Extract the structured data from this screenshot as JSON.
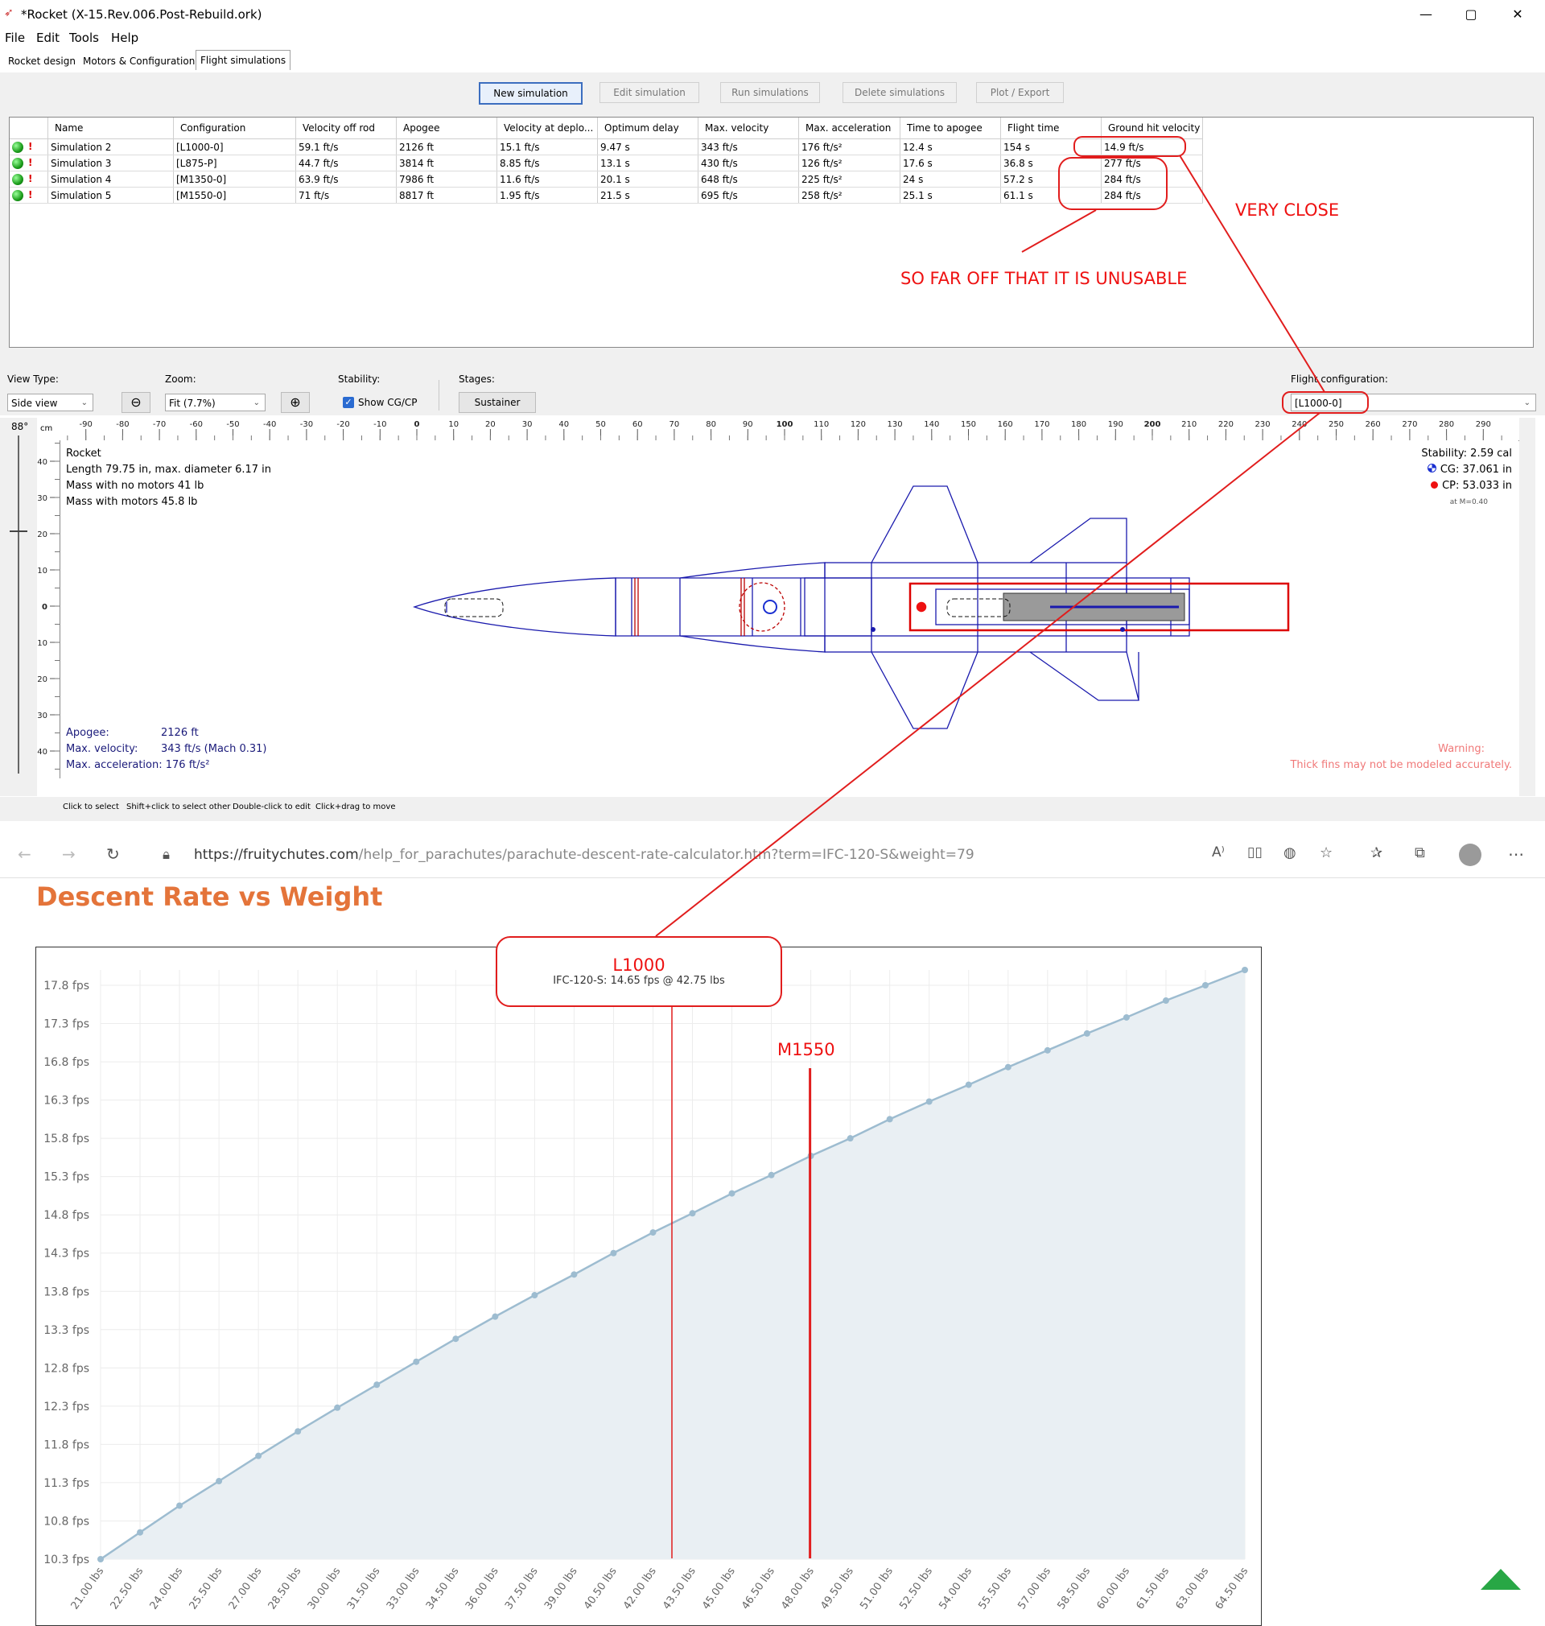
{
  "window": {
    "title": "*Rocket (X-15.Rev.006.Post-Rebuild.ork)",
    "minimize": "—",
    "restore": "▢",
    "close": "✕"
  },
  "menu": [
    "File",
    "Edit",
    "Tools",
    "Help"
  ],
  "tabs": [
    "Rocket design",
    "Motors & Configuration",
    "Flight simulations"
  ],
  "toolbar": {
    "new": "New simulation",
    "edit": "Edit simulation",
    "run": "Run simulations",
    "delete": "Delete simulations",
    "plot": "Plot / Export"
  },
  "sim_table": {
    "headers": [
      "Name",
      "Configuration",
      "Velocity off rod",
      "Apogee",
      "Velocity at deplo...",
      "Optimum delay",
      "Max. velocity",
      "Max. acceleration",
      "Time to apogee",
      "Flight time",
      "Ground hit velocity"
    ],
    "rows": [
      [
        "Simulation 2",
        "[L1000-0]",
        "59.1 ft/s",
        "2126 ft",
        "15.1 ft/s",
        "9.47 s",
        "343 ft/s",
        "176 ft/s²",
        "12.4 s",
        "154 s",
        "14.9 ft/s"
      ],
      [
        "Simulation 3",
        "[L875-P]",
        "44.7 ft/s",
        "3814 ft",
        "8.85 ft/s",
        "13.1 s",
        "430 ft/s",
        "126 ft/s²",
        "17.6 s",
        "36.8 s",
        "277 ft/s"
      ],
      [
        "Simulation 4",
        "[M1350-0]",
        "63.9 ft/s",
        "7986 ft",
        "11.6 ft/s",
        "20.1 s",
        "648 ft/s",
        "225 ft/s²",
        "24 s",
        "57.2 s",
        "284 ft/s"
      ],
      [
        "Simulation 5",
        "[M1550-0]",
        "71 ft/s",
        "8817 ft",
        "1.95 ft/s",
        "21.5 s",
        "695 ft/s",
        "258 ft/s²",
        "25.1 s",
        "61.1 s",
        "284 ft/s"
      ]
    ],
    "warn_mark": "!"
  },
  "annotations": {
    "very_close": "VERY CLOSE",
    "unusable": "SO FAR OFF THAT IT IS UNUSABLE",
    "l1000": "L1000",
    "m1550": "M1550",
    "color": "#e11d1d"
  },
  "controls": {
    "view_type_label": "View Type:",
    "view_type": "Side view",
    "zoom_label": "Zoom:",
    "zoom": "Fit (7.7%)",
    "stability_label": "Stability:",
    "show_cgcp": "Show CG/CP",
    "stages_label": "Stages:",
    "stage": "Sustainer",
    "flight_config_label": "Flight configuration:",
    "flight_config": "[L1000-0]"
  },
  "ruler": {
    "angle": "88°",
    "unit": "cm",
    "top_ticks": [
      -90,
      -80,
      -70,
      -60,
      -50,
      -40,
      -30,
      -20,
      -10,
      0,
      10,
      20,
      30,
      40,
      50,
      60,
      70,
      80,
      90,
      100,
      110,
      120,
      130,
      140,
      150,
      160,
      170,
      180,
      190,
      200,
      210,
      220,
      230,
      240,
      250,
      260,
      270,
      280,
      290
    ],
    "left_ticks": [
      40,
      30,
      20,
      10,
      0,
      -10,
      -20,
      -30,
      -40
    ]
  },
  "rocket_info": {
    "name": "Rocket",
    "length": "Length 79.75 in, max. diameter 6.17 in",
    "mass_no_motors": "Mass with no motors 41 lb",
    "mass_motors": "Mass with motors 45.8 lb"
  },
  "stability_info": {
    "stability": "Stability:  2.59 cal",
    "cg": "CG: 37.061 in",
    "cp": "CP: 53.033 in",
    "mach": "at M=0.40"
  },
  "flight_summary": {
    "apogee_label": "Apogee:",
    "apogee": "2126 ft",
    "maxv_label": "Max. velocity:",
    "maxv": "343 ft/s  (Mach 0.31)",
    "maxa_label": "Max. acceleration:",
    "maxa": "176 ft/s²"
  },
  "warning": {
    "title": "Warning:",
    "text": "Thick fins may not be modeled accurately."
  },
  "hints": {
    "select": "Click to select",
    "shift": "Shift+click to select other",
    "dbl": "Double-click to edit",
    "drag": "Click+drag to move"
  },
  "browser": {
    "url_host": "https://fruitychutes.com",
    "url_path": "/help_for_parachutes/parachute-descent-rate-calculator.htm?term=IFC-120-S&weight=79"
  },
  "page_heading": "Descent Rate vs Weight",
  "tooltip": {
    "text": "IFC-120-S: 14.65 fps @ 42.75 lbs"
  },
  "chart_data": {
    "type": "area",
    "x": [
      21.0,
      22.5,
      24.0,
      25.5,
      27.0,
      28.5,
      30.0,
      31.5,
      33.0,
      34.5,
      36.0,
      37.5,
      39.0,
      40.5,
      42.0,
      43.5,
      45.0,
      46.5,
      48.0,
      49.5,
      51.0,
      52.5,
      54.0,
      55.5,
      57.0,
      58.5,
      60.0,
      61.5,
      63.0,
      64.5
    ],
    "x_tick_labels": [
      "21.00 lbs",
      "22.50 lbs",
      "24.00 lbs",
      "25.50 lbs",
      "27.00 lbs",
      "28.50 lbs",
      "30.00 lbs",
      "31.50 lbs",
      "33.00 lbs",
      "34.50 lbs",
      "36.00 lbs",
      "37.50 lbs",
      "39.00 lbs",
      "40.50 lbs",
      "42.00 lbs",
      "43.50 lbs",
      "45.00 lbs",
      "46.50 lbs",
      "48.00 lbs",
      "49.50 lbs",
      "51.00 lbs",
      "52.50 lbs",
      "54.00 lbs",
      "55.50 lbs",
      "57.00 lbs",
      "58.50 lbs",
      "60.00 lbs",
      "61.50 lbs",
      "63.00 lbs",
      "64.50 lbs"
    ],
    "series": [
      {
        "values": [
          10.3,
          10.65,
          11.0,
          11.32,
          11.65,
          11.97,
          12.28,
          12.58,
          12.88,
          13.18,
          13.47,
          13.75,
          14.02,
          14.3,
          14.57,
          14.82,
          15.08,
          15.32,
          15.57,
          15.8,
          16.05,
          16.28,
          16.5,
          16.73,
          16.95,
          17.17,
          17.38,
          17.6,
          17.8,
          18.0
        ]
      }
    ],
    "y_ticks": [
      10.3,
      10.8,
      11.3,
      11.8,
      12.3,
      12.8,
      13.3,
      13.8,
      14.3,
      14.8,
      15.3,
      15.8,
      16.3,
      16.8,
      17.3,
      17.8
    ],
    "y_tick_labels": [
      "10.3 fps",
      "10.8 fps",
      "11.3 fps",
      "11.8 fps",
      "12.3 fps",
      "12.8 fps",
      "13.3 fps",
      "13.8 fps",
      "14.3 fps",
      "14.8 fps",
      "15.3 fps",
      "15.8 fps",
      "16.3 fps",
      "16.8 fps",
      "17.3 fps",
      "17.8 fps"
    ],
    "ylim": [
      10.3,
      18.0
    ],
    "xlim": [
      21.0,
      64.5
    ],
    "grid": true,
    "line_color": "#9dbcd0",
    "fill_color": "#e9eff3",
    "marker_l1000": 42.75,
    "marker_m1550": 48.0
  }
}
